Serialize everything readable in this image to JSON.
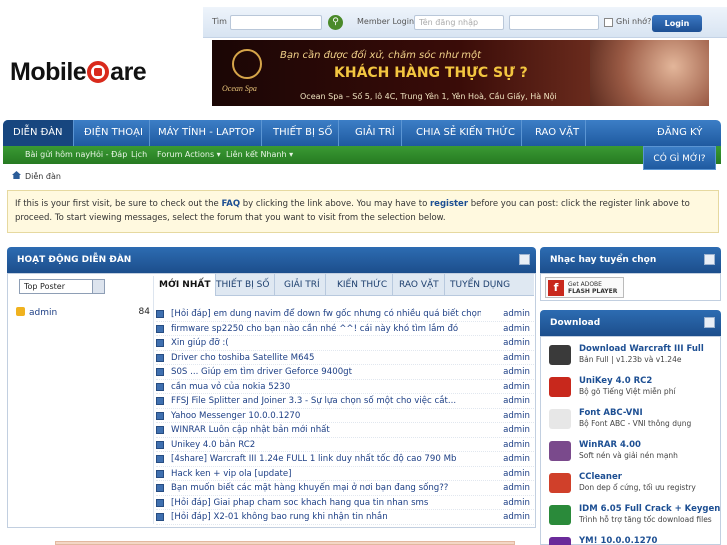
{
  "logo": {
    "part1": "Mobile",
    "part2": "are"
  },
  "login": {
    "search_label": "Tìm",
    "member_label": "Member Login:",
    "username_placeholder": "Tên đăng nhập",
    "remember_label": "Ghi nhớ?",
    "login_button": "Login"
  },
  "banner": {
    "brand": "Ocean Spa",
    "line1": "Bạn cần được đối xử, chăm sóc như một",
    "line2": "KHÁCH HÀNG THỰC SỰ ?",
    "address": "Ocean Spa – Số 5, lô 4C, Trung Yên 1, Yên Hoà, Cầu Giấy, Hà Nội"
  },
  "nav": {
    "items": [
      "DIỄN ĐÀN",
      "ĐIỆN THOẠI",
      "MÁY TÍNH - LAPTOP",
      "THIẾT BỊ SỐ",
      "GIẢI TRÍ",
      "CHIA SẺ KIẾN THỨC",
      "RAO VẶT"
    ],
    "register": "ĐĂNG KÝ",
    "whats_new": "CÓ GÌ MỚI?"
  },
  "subnav": [
    "Bài gửi hôm nay",
    "Hỏi - Đáp",
    "Lịch",
    "Forum Actions ▾",
    "Liên kết Nhanh ▾"
  ],
  "breadcrumb": "Diễn đàn",
  "notice": {
    "p1": "If this is your first visit, be sure to check out the",
    "faq": "FAQ",
    "p2": "by clicking the link above. You may have to",
    "register": "register",
    "p3": "before you can post: click the register link above to proceed. To start viewing messages, select the forum that you want to visit from the selection below."
  },
  "forum_activity": {
    "title": "HOẠT ĐỘNG DIỄN ĐÀN",
    "poster_select": "Top Poster",
    "poster": {
      "name": "admin",
      "count": "84"
    },
    "tabs": [
      "MỚI NHẤT",
      "THIẾT BỊ SỐ",
      "GIẢI TRÍ",
      "KIẾN THỨC",
      "RAO VẶT",
      "TUYỂN DỤNG"
    ],
    "threads": [
      {
        "title": "[Hỏi đáp] em dung navim để down fw gốc nhưng có nhiều quá biết chọn...",
        "author": "admin"
      },
      {
        "title": "firmware sp2250 cho bạn nào cần nhé ^^! cái này khó tìm lắm đó",
        "author": "admin"
      },
      {
        "title": "Xin giúp đỡ :(",
        "author": "admin"
      },
      {
        "title": "Driver cho toshiba Satellite M645",
        "author": "admin"
      },
      {
        "title": "S0S ... Giúp em tìm driver Geforce 9400gt",
        "author": "admin"
      },
      {
        "title": "cần mua vỏ của nokia 5230",
        "author": "admin"
      },
      {
        "title": "FFSJ File Splitter and Joiner 3.3 - Sự lựa chọn số một cho việc cắt...",
        "author": "admin"
      },
      {
        "title": "Yahoo Messenger 10.0.0.1270",
        "author": "admin"
      },
      {
        "title": "WINRAR Luôn cập nhật bản mới nhất",
        "author": "admin"
      },
      {
        "title": "Unikey 4.0 bản RC2",
        "author": "admin"
      },
      {
        "title": "[4share] Warcraft III 1.24e FULL 1 link duy nhất tốc độ cao 790 Mb",
        "author": "admin"
      },
      {
        "title": "Hack ken + vip ola [update]",
        "author": "admin"
      },
      {
        "title": "Bạn muốn biết các mặt hàng khuyến mại ở nơi bạn đang sống??",
        "author": "admin"
      },
      {
        "title": "[Hỏi đáp] Giai phap cham soc khach hang qua tin nhan sms",
        "author": "admin"
      },
      {
        "title": "[Hỏi đáp] X2-01 không bao rung khi nhận tin nhắn",
        "author": "admin"
      }
    ]
  },
  "music": {
    "title": "Nhạc hay tuyển chọn",
    "flash_line1": "Get ADOBE",
    "flash_line2": "FLASH PLAYER"
  },
  "downloads": {
    "title": "Download",
    "items": [
      {
        "name": "Download Warcraft III Full",
        "desc": "Bản Full | v1.23b và v1.24e",
        "color": "#3a3a3a"
      },
      {
        "name": "UniKey 4.0 RC2",
        "desc": "Bộ gõ Tiếng Việt miễn phí",
        "color": "#c8281c"
      },
      {
        "name": "Font ABC-VNI",
        "desc": "Bộ Font ABC - VNI thông dụng",
        "color": "#e7e7e7"
      },
      {
        "name": "WinRAR 4.00",
        "desc": "Soft nén và giải nén mạnh",
        "color": "#7a4a8c"
      },
      {
        "name": "CCleaner",
        "desc": "Don dep ổ cứng, tối ưu registry",
        "color": "#d0402a"
      },
      {
        "name": "IDM 6.05 Full Crack + Keygen",
        "desc": "Trình hỗ trợ tăng tốc download files",
        "color": "#2a8a3a"
      },
      {
        "name": "YM! 10.0.0.1270",
        "desc": "",
        "color": "#6a2a9a"
      }
    ]
  }
}
